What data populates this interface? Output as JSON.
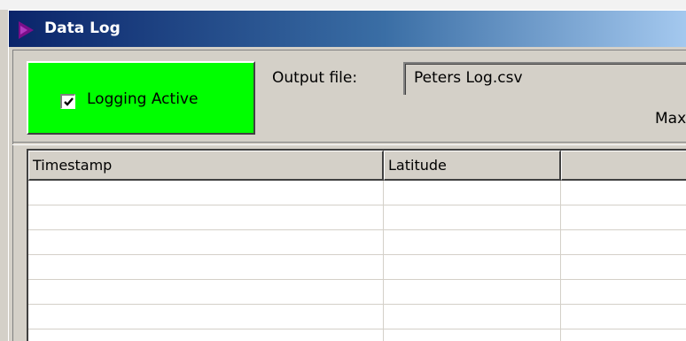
{
  "window": {
    "title": "Data Log",
    "icon": "play-triangle-icon"
  },
  "logging": {
    "checkbox_label": "Logging Active",
    "checked": true,
    "panel_color": "#00ff00"
  },
  "output": {
    "label": "Output file:",
    "value": "Peters Log.csv"
  },
  "max_label": "Max",
  "table": {
    "columns": [
      "Timestamp",
      "Latitude",
      ""
    ],
    "rows": [
      [
        "",
        "",
        ""
      ],
      [
        "",
        "",
        ""
      ],
      [
        "",
        "",
        ""
      ],
      [
        "",
        "",
        ""
      ],
      [
        "",
        "",
        ""
      ],
      [
        "",
        "",
        ""
      ],
      [
        "",
        "",
        ""
      ]
    ]
  },
  "colors": {
    "title_bar_start": "#0a246a",
    "title_bar_end": "#a6caf0",
    "face": "#d4d0c8"
  }
}
